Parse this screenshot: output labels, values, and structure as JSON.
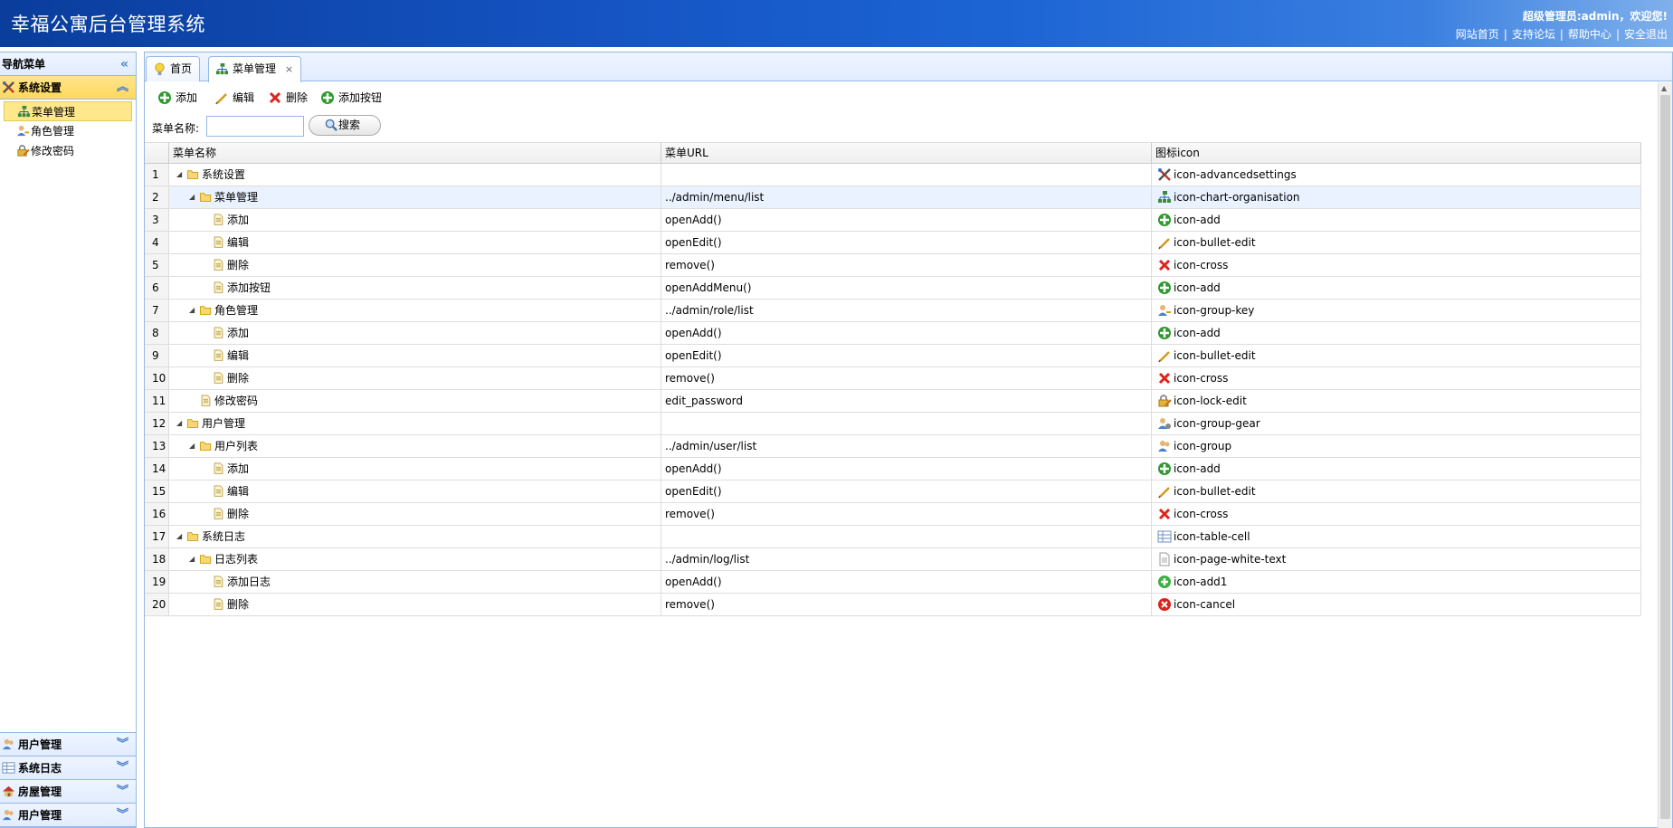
{
  "header": {
    "title": "幸福公寓后台管理系统",
    "user_info": "超级管理员:admin，欢迎您!",
    "links": [
      "网站首页",
      "支持论坛",
      "帮助中心",
      "安全退出"
    ],
    "link_separator": "|"
  },
  "sidebar": {
    "nav_title": "导航菜单",
    "collapse_glyph": "«",
    "sections": [
      {
        "label": "系统设置",
        "icon": "advanced-settings-icon"
      },
      {
        "label": "用户管理",
        "icon": "group-icon"
      },
      {
        "label": "系统日志",
        "icon": "table-cell-icon"
      },
      {
        "label": "房屋管理",
        "icon": "house-icon"
      },
      {
        "label": "用户管理",
        "icon": "group-icon"
      }
    ],
    "tree_items": [
      {
        "label": "菜单管理",
        "icon": "chart-organisation-icon"
      },
      {
        "label": "角色管理",
        "icon": "group-key-icon"
      },
      {
        "label": "修改密码",
        "icon": "lock-edit-icon"
      }
    ]
  },
  "tabs": [
    {
      "label": "首页",
      "icon": "lightbulb-icon"
    },
    {
      "label": "菜单管理",
      "icon": "chart-organisation-icon",
      "close": "×"
    }
  ],
  "toolbar": {
    "add": "添加",
    "edit": "编辑",
    "remove": "删除",
    "add_button": "添加按钮",
    "search_label": "菜单名称:",
    "search_value": "",
    "search_button": "搜索"
  },
  "grid": {
    "headers": [
      "菜单名称",
      "菜单URL",
      "图标icon"
    ],
    "rows": [
      {
        "n": "1",
        "name": "系统设置",
        "url": "",
        "icon": "icon-advancedsettings"
      },
      {
        "n": "2",
        "name": "菜单管理",
        "url": "../admin/menu/list",
        "icon": "icon-chart-organisation"
      },
      {
        "n": "3",
        "name": "添加",
        "url": "openAdd()",
        "icon": "icon-add"
      },
      {
        "n": "4",
        "name": "编辑",
        "url": "openEdit()",
        "icon": "icon-bullet-edit"
      },
      {
        "n": "5",
        "name": "删除",
        "url": "remove()",
        "icon": "icon-cross"
      },
      {
        "n": "6",
        "name": "添加按钮",
        "url": "openAddMenu()",
        "icon": "icon-add"
      },
      {
        "n": "7",
        "name": "角色管理",
        "url": "../admin/role/list",
        "icon": "icon-group-key"
      },
      {
        "n": "8",
        "name": "添加",
        "url": "openAdd()",
        "icon": "icon-add"
      },
      {
        "n": "9",
        "name": "编辑",
        "url": "openEdit()",
        "icon": "icon-bullet-edit"
      },
      {
        "n": "10",
        "name": "删除",
        "url": "remove()",
        "icon": "icon-cross"
      },
      {
        "n": "11",
        "name": "修改密码",
        "url": "edit_password",
        "icon": "icon-lock-edit"
      },
      {
        "n": "12",
        "name": "用户管理",
        "url": "",
        "icon": "icon-group-gear"
      },
      {
        "n": "13",
        "name": "用户列表",
        "url": "../admin/user/list",
        "icon": "icon-group"
      },
      {
        "n": "14",
        "name": "添加",
        "url": "openAdd()",
        "icon": "icon-add"
      },
      {
        "n": "15",
        "name": "编辑",
        "url": "openEdit()",
        "icon": "icon-bullet-edit"
      },
      {
        "n": "16",
        "name": "删除",
        "url": "remove()",
        "icon": "icon-cross"
      },
      {
        "n": "17",
        "name": "系统日志",
        "url": "",
        "icon": "icon-table-cell"
      },
      {
        "n": "18",
        "name": "日志列表",
        "url": "../admin/log/list",
        "icon": "icon-page-white-text"
      },
      {
        "n": "19",
        "name": "添加日志",
        "url": "openAdd()",
        "icon": "icon-add1"
      },
      {
        "n": "20",
        "name": "删除",
        "url": "remove()",
        "icon": "icon-cancel"
      }
    ]
  }
}
